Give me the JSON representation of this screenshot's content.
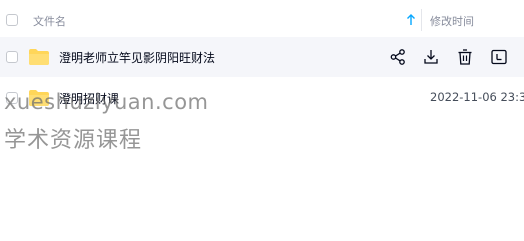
{
  "header": {
    "name_label": "文件名",
    "time_label": "修改时间",
    "sort": "ascending-arrow-icon"
  },
  "files": [
    {
      "name": "澄明老师立竿见影阴阳旺财法",
      "modified": "",
      "type": "folder",
      "hovered": true,
      "actions": [
        "share-icon",
        "download-icon",
        "delete-icon",
        "more-icon"
      ]
    },
    {
      "name": "澄明招财课",
      "modified": "2022-11-06 23:3",
      "type": "folder",
      "hovered": false
    }
  ],
  "watermark": {
    "line1": "xueshuziyuan.com",
    "line2": "学术资源课程"
  },
  "colors": {
    "accent": "#06a7ff",
    "folder": "#ffd659",
    "hover_bg": "#f5f6fa"
  }
}
